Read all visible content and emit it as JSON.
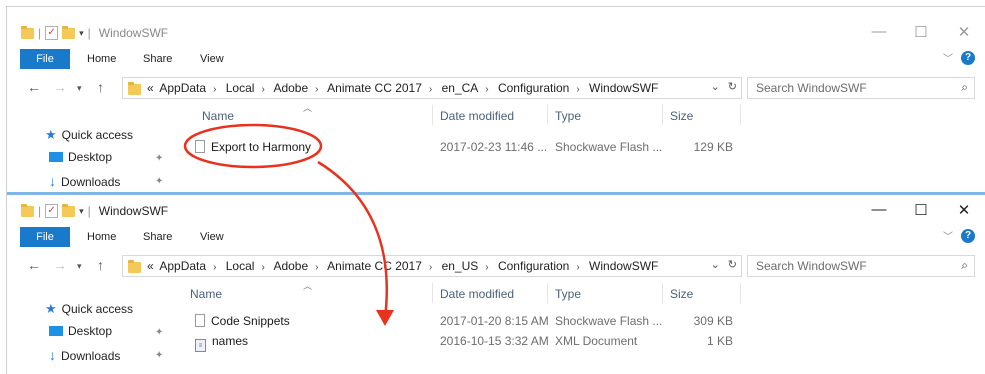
{
  "window1": {
    "title": "WindowSWF",
    "tabs": {
      "file": "File",
      "home": "Home",
      "share": "Share",
      "view": "View"
    },
    "breadcrumb": {
      "prefix": "«",
      "items": [
        "AppData",
        "Local",
        "Adobe",
        "Animate CC 2017",
        "en_CA",
        "Configuration",
        "WindowSWF"
      ]
    },
    "search_placeholder": "Search WindowSWF",
    "sidebar": {
      "quick_access": "Quick access",
      "desktop": "Desktop",
      "downloads": "Downloads"
    },
    "columns": {
      "name": "Name",
      "date": "Date modified",
      "type": "Type",
      "size": "Size"
    },
    "files": [
      {
        "name": "Export to Harmony",
        "date": "2017-02-23 11:46 ...",
        "type": "Shockwave Flash ...",
        "size": "129 KB",
        "icon": "file-icon"
      }
    ]
  },
  "window2": {
    "title": "WindowSWF",
    "tabs": {
      "file": "File",
      "home": "Home",
      "share": "Share",
      "view": "View"
    },
    "breadcrumb": {
      "prefix": "«",
      "items": [
        "AppData",
        "Local",
        "Adobe",
        "Animate CC 2017",
        "en_US",
        "Configuration",
        "WindowSWF"
      ]
    },
    "search_placeholder": "Search WindowSWF",
    "sidebar": {
      "quick_access": "Quick access",
      "desktop": "Desktop",
      "downloads": "Downloads"
    },
    "columns": {
      "name": "Name",
      "date": "Date modified",
      "type": "Type",
      "size": "Size"
    },
    "files": [
      {
        "name": "Code Snippets",
        "date": "2017-01-20 8:15 AM",
        "type": "Shockwave Flash ...",
        "size": "309 KB",
        "icon": "file-icon"
      },
      {
        "name": "names",
        "date": "2016-10-15 3:32 AM",
        "type": "XML Document",
        "size": "1 KB",
        "icon": "xml-file-icon"
      }
    ]
  },
  "colors": {
    "accent": "#1979ca",
    "annotation": "#e8321e"
  }
}
